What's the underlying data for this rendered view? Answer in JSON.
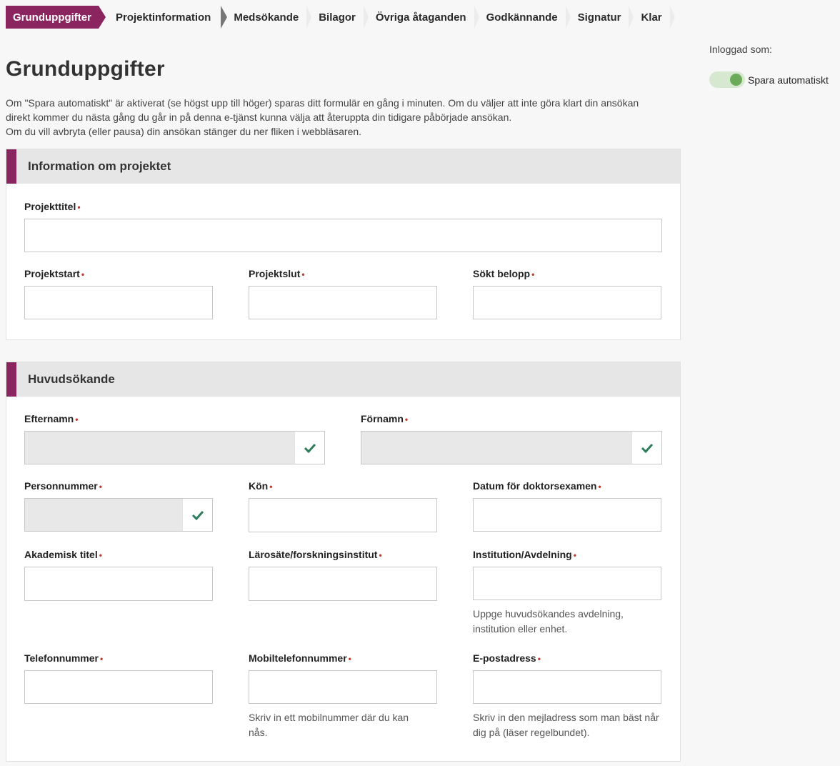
{
  "steps": [
    "Grunduppgifter",
    "Projektinformation",
    "Medsökande",
    "Bilagor",
    "Övriga åtaganden",
    "Godkännande",
    "Signatur",
    "Klar"
  ],
  "page": {
    "title": "Grunduppgifter",
    "intro": [
      "Om \"Spara automatiskt\" är aktiverat (se högst upp till höger) sparas ditt formulär en gång i minuten. Om du väljer att inte göra klart din ansökan",
      "direkt kommer du nästa gång du går in på denna e-tjänst kunna välja att återuppta din tidigare påbörjade ansökan.",
      "Om du vill avbryta (eller pausa) din ansökan stänger du ner fliken i webbläsaren."
    ]
  },
  "sidebar": {
    "logged_in_label": "Inloggad som:",
    "autosave_label": "Spara automatiskt",
    "autosave_on": true
  },
  "colors": {
    "brand": "#8a2560",
    "check": "#2e7d5b",
    "toggle": "#6cab5a",
    "required": "#c0392b"
  },
  "project": {
    "header": "Information om projektet",
    "fields": {
      "title": "Projekttitel",
      "start": "Projektstart",
      "end": "Projektslut",
      "amount": "Sökt belopp"
    }
  },
  "applicant": {
    "header": "Huvudsökande",
    "fields": {
      "lastname": "Efternamn",
      "firstname": "Förnamn",
      "pnr": "Personnummer",
      "gender": "Kön",
      "phd_date": "Datum för doktorsexamen",
      "title": "Akademisk titel",
      "university": "Lärosäte/forskningsinstitut",
      "department": "Institution/Avdelning",
      "phone": "Telefonnummer",
      "mobile": "Mobiltelefonnummer",
      "email": "E-postadress"
    },
    "help": {
      "department": "Uppge huvudsökandes avdelning, institution eller enhet.",
      "mobile": "Skriv in ett mobilnummer där du kan nås.",
      "email": "Skriv in den mejladress som man bäst når dig på (läser regelbundet)."
    }
  },
  "required_marker": "•"
}
